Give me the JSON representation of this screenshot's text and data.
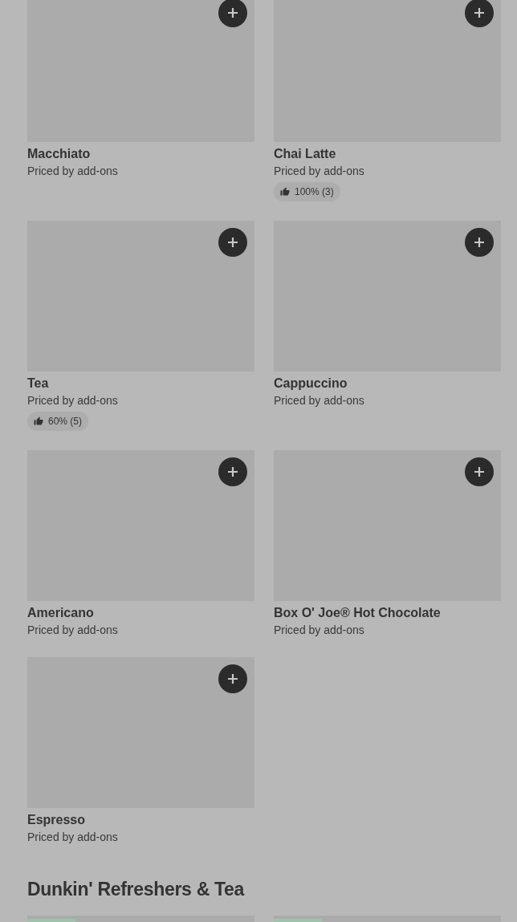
{
  "items": [
    {
      "name": "Macchiato",
      "subtitle": "Priced by add-ons"
    },
    {
      "name": "Chai Latte",
      "subtitle": "Priced by add-ons",
      "rating": "100% (3)"
    },
    {
      "name": "Tea",
      "subtitle": "Priced by add-ons",
      "rating": "60% (5)"
    },
    {
      "name": "Cappuccino",
      "subtitle": "Priced by add-ons"
    },
    {
      "name": "Americano",
      "subtitle": "Priced by add-ons"
    },
    {
      "name": "Box O' Joe® Hot Chocolate",
      "subtitle": "Priced by add-ons"
    },
    {
      "name": "Espresso",
      "subtitle": "Priced by add-ons"
    }
  ],
  "next_section": {
    "title": "Dunkin' Refreshers & Tea",
    "items": [
      {
        "kind": "picture",
        "tagged": true
      },
      {
        "kind": "picture",
        "tagged": true
      }
    ]
  }
}
